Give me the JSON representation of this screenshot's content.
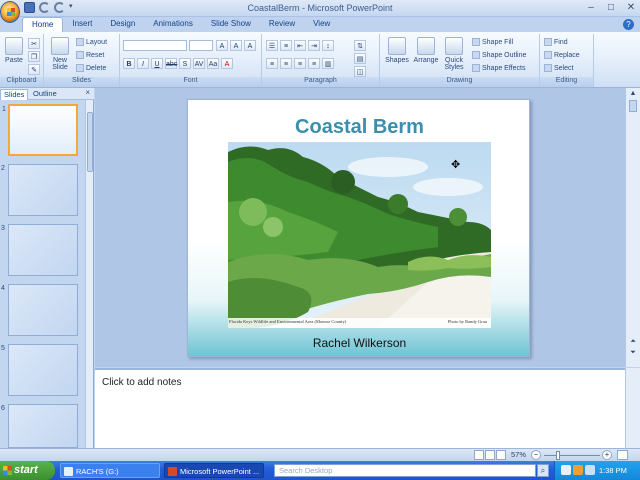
{
  "window": {
    "title": "CoastalBerm - Microsoft PowerPoint",
    "minimize": "–",
    "maximize": "□",
    "close": "✕"
  },
  "ribbon_tabs": [
    {
      "label": "Home",
      "active": true
    },
    {
      "label": "Insert"
    },
    {
      "label": "Design"
    },
    {
      "label": "Animations"
    },
    {
      "label": "Slide Show"
    },
    {
      "label": "Review"
    },
    {
      "label": "View"
    }
  ],
  "help": "?",
  "groups": {
    "clipboard": {
      "label": "Clipboard",
      "paste": "Paste"
    },
    "slides": {
      "label": "Slides",
      "new_slide": "New Slide",
      "layout": "Layout",
      "reset": "Reset",
      "delete": "Delete"
    },
    "font": {
      "label": "Font",
      "bold": "B",
      "italic": "I",
      "underline": "U",
      "strike": "abc",
      "shadow": "S",
      "spacing": "AV",
      "case": "Aa",
      "grow": "A",
      "shrink": "A",
      "clear": "A"
    },
    "paragraph": {
      "label": "Paragraph"
    },
    "drawing": {
      "label": "Drawing",
      "shapes": "Shapes",
      "arrange": "Arrange",
      "quick_styles": "Quick Styles",
      "shape_fill": "Shape Fill",
      "shape_outline": "Shape Outline",
      "shape_effects": "Shape Effects"
    },
    "editing": {
      "label": "Editing",
      "find": "Find",
      "replace": "Replace",
      "select": "Select"
    }
  },
  "left_pane": {
    "tabs": [
      {
        "label": "Slides",
        "active": true
      },
      {
        "label": "Outline"
      }
    ],
    "close": "×",
    "slide_numbers": [
      "1",
      "2",
      "3",
      "4",
      "5",
      "6"
    ]
  },
  "slide": {
    "title": "Coastal Berm",
    "caption_left": "Florida Keys Wildlife and Environmental Area (Monroe County)",
    "caption_right": "Photo by Randy Grau",
    "subtitle": "Rachel Wilkerson"
  },
  "notes": {
    "placeholder": "Click to add notes"
  },
  "status": {
    "zoom": "57%",
    "zoom_minus": "−",
    "zoom_plus": "+",
    "zoom_fraction": 0.57
  },
  "taskbar": {
    "start": "start",
    "tasks": [
      {
        "label": "RACH'S (G:)"
      },
      {
        "label": "Microsoft PowerPoint ..."
      }
    ],
    "search_placeholder": "Search Desktop",
    "search_go": "⌕",
    "clock": "1:38 PM"
  },
  "colors": {
    "title_accent": "#3a8fae",
    "slide_bottom_teal": "#6ec4d4",
    "selected_thumb": "#f2a83a",
    "taskbar_blue": "#245edb",
    "start_green": "#3c8f2f"
  }
}
